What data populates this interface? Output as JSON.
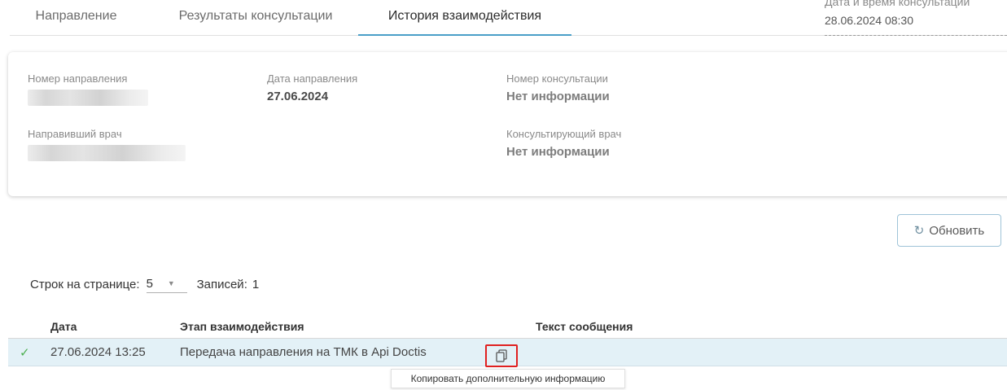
{
  "tabs": [
    {
      "label": "Направление"
    },
    {
      "label": "Результаты консультации"
    },
    {
      "label": "История взаимодействия",
      "active": true
    }
  ],
  "consultation_datetime": {
    "label": "Дата и время консультации",
    "value": "28.06.2024 08:30"
  },
  "info": {
    "referral_number_label": "Номер направления",
    "referral_date_label": "Дата направления",
    "referral_date_value": "27.06.2024",
    "consultation_number_label": "Номер консультации",
    "consultation_number_value": "Нет информации",
    "referring_doctor_label": "Направивший врач",
    "consulting_doctor_label": "Консультирующий врач",
    "consulting_doctor_value": "Нет информации"
  },
  "refresh_label": "Обновить",
  "pagination": {
    "rows_label": "Строк на странице:",
    "rows_value": "5",
    "records_label": "Записей:",
    "records_count": "1"
  },
  "table": {
    "headers": [
      "Дата",
      "Этап взаимодействия",
      "Текст сообщения"
    ],
    "rows": [
      {
        "status": "✓",
        "date": "27.06.2024 13:25",
        "stage": "Передача направления на ТМК в Api Doctis",
        "message": ""
      }
    ]
  },
  "tooltip": "Копировать дополнительную информацию",
  "colors": {
    "accent": "#4a9fc8",
    "selected_row": "#e3f1f7",
    "highlight": "#e02020",
    "success": "#4caf50"
  }
}
